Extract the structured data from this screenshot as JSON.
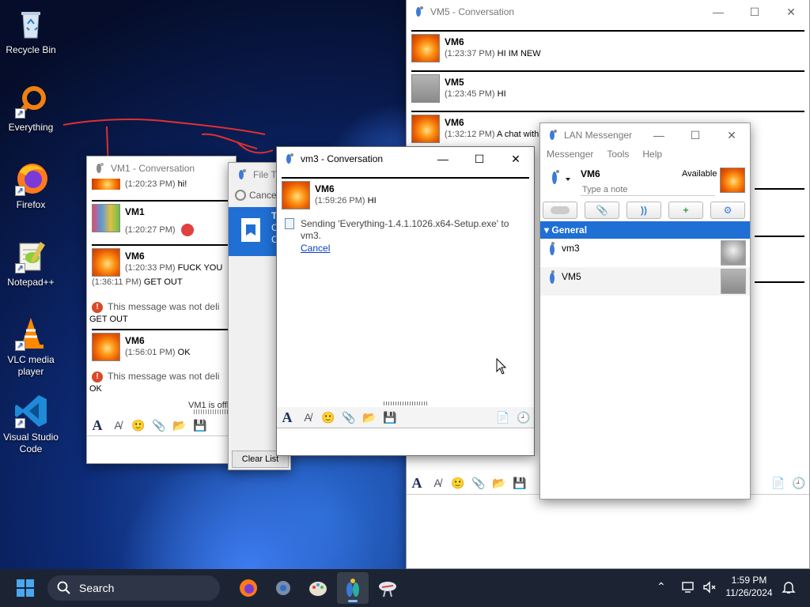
{
  "desktop": {
    "icons": [
      {
        "label": "Recycle Bin"
      },
      {
        "label": "Everything"
      },
      {
        "label": "Firefox"
      },
      {
        "label": "Notepad++"
      },
      {
        "label": "VLC media player"
      },
      {
        "label": "Visual Studio Code"
      }
    ]
  },
  "vm5_window": {
    "title": "VM5 - Conversation",
    "messages": [
      {
        "name": "VM6",
        "time": "(1:23:37 PM)",
        "text": "HI IM NEW"
      },
      {
        "name": "VM5",
        "time": "(1:23:45 PM)",
        "text": "HI"
      },
      {
        "name": "VM6",
        "time": "(1:32:12 PM)",
        "text": "A chat with"
      }
    ]
  },
  "vm1_window": {
    "title": "VM1 - Conversation",
    "msg0": {
      "time": "(1:20:23 PM)",
      "text": "hi!"
    },
    "msg1": {
      "name": "VM1",
      "time": "(1:20:27 PM)"
    },
    "msg2": {
      "name": "VM6",
      "time": "(1:20:33 PM)",
      "text": "FUCK YOU",
      "time2": "(1:36:11 PM)",
      "text2": "GET OUT"
    },
    "error1": {
      "text": "This message was not deli",
      "quote": "GET OUT"
    },
    "msg3": {
      "name": "VM6",
      "time": "(1:56:01 PM)",
      "text": "OK"
    },
    "error2": {
      "text": "This message was not deli",
      "quote": "OK"
    },
    "status": "VM1 is offl"
  },
  "file_transfer": {
    "title": "File Tr",
    "cancel_label": "Cancel",
    "item_letters": [
      "T",
      "C",
      "C"
    ],
    "clear_label": "Clear List"
  },
  "vm3_window": {
    "title": "vm3 - Conversation",
    "message": {
      "name": "VM6",
      "time": "(1:59:26 PM)",
      "text": "HI"
    },
    "sending_text": "Sending 'Everything-1.4.1.1026.x64-Setup.exe' to vm3.",
    "cancel_link": "Cancel"
  },
  "lan_messenger": {
    "title": "LAN Messenger",
    "menu": [
      "Messenger",
      "Tools",
      "Help"
    ],
    "user": {
      "name": "VM6",
      "status": "Available",
      "note_placeholder": "Type a note"
    },
    "group": "General",
    "contacts": [
      {
        "name": "vm3"
      },
      {
        "name": "VM5"
      }
    ]
  },
  "taskbar": {
    "search_label": "Search",
    "time": "1:59 PM",
    "date": "11/26/2024"
  },
  "colors": {
    "accent": "#1f6fd4",
    "group_header": "#1f6fd4",
    "error": "#d84a2a",
    "taskbar": "#1c2434"
  }
}
